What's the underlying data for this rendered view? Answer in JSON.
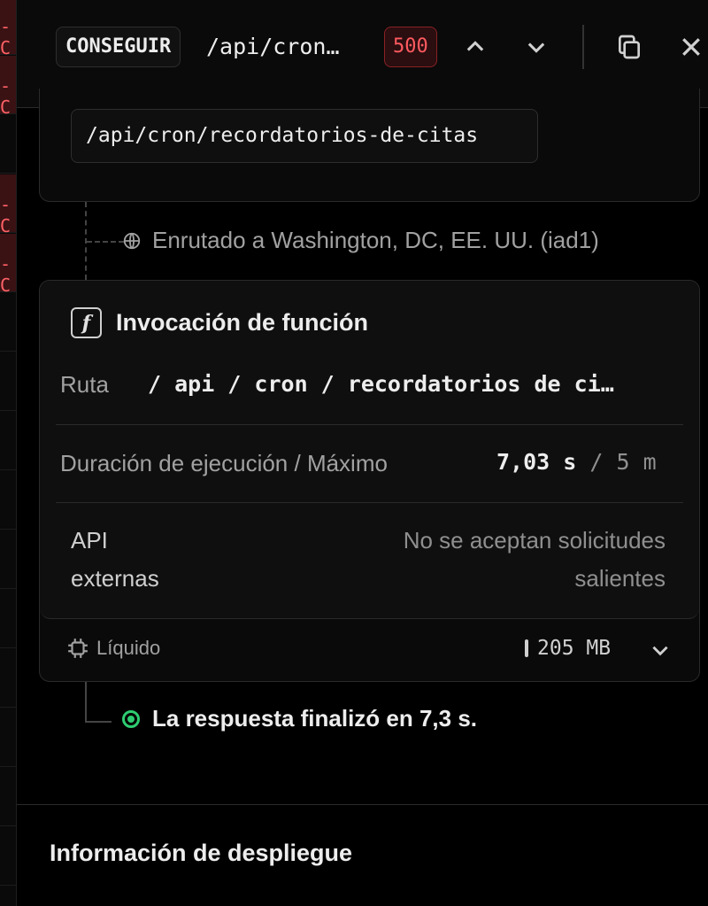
{
  "left_strip": {
    "rows": [
      {
        "text": "-C",
        "error": true
      },
      {
        "text": "-C",
        "error": true
      },
      {
        "text": "",
        "error": false
      },
      {
        "text": "-C",
        "error": true
      },
      {
        "text": "-C",
        "error": true
      },
      {
        "text": "",
        "error": false
      },
      {
        "text": "",
        "error": false
      },
      {
        "text": "",
        "error": false
      },
      {
        "text": "",
        "error": false
      },
      {
        "text": "",
        "error": false
      },
      {
        "text": "",
        "error": false
      },
      {
        "text": "",
        "error": false
      },
      {
        "text": "",
        "error": false
      },
      {
        "text": "",
        "error": false
      },
      {
        "text": "",
        "error": false
      }
    ]
  },
  "header": {
    "method": "CONSEGUIR",
    "path": "/api/cron…",
    "status_code": "500",
    "prev_icon": "chevron-up-icon",
    "next_icon": "chevron-down-icon",
    "copy_icon": "copy-icon",
    "close_icon": "close-icon"
  },
  "request": {
    "full_path": "/api/cron/recordatorios-de-citas",
    "routed_text": "Enrutado a Washington, DC, EE. UU. (iad1)"
  },
  "function": {
    "title": "Invocación de función",
    "route_label": "Ruta",
    "route_value": "/ api / cron / recordatorios de ci…",
    "duration_label": "Duración de ejecución / Máximo",
    "duration_value": "7,03 s",
    "duration_sep": "/",
    "duration_max": "5 m",
    "external_label": "API externas",
    "external_value": "No se aceptan solicitudes salientes",
    "runtime_label": "Líquido",
    "memory": "205 MB"
  },
  "response": {
    "text": "La respuesta finalizó en 7,3 s.",
    "status_color": "#2ecc71"
  },
  "deployment": {
    "title": "Información de despliegue"
  }
}
